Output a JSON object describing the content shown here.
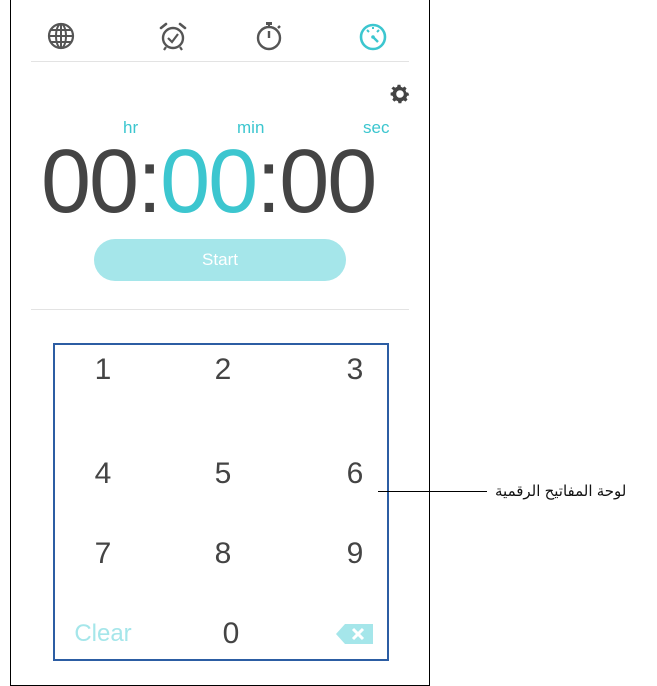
{
  "tabs": [
    {
      "name": "world-clock",
      "icon": "globe-icon"
    },
    {
      "name": "alarm",
      "icon": "alarm-clock-icon"
    },
    {
      "name": "stopwatch",
      "icon": "stopwatch-icon"
    },
    {
      "name": "timer",
      "icon": "timer-icon",
      "active": true
    }
  ],
  "colors": {
    "accent": "#3cc6cf",
    "accent_light": "#a5e6ea",
    "text": "#444444",
    "frame_blue": "#2c5da3"
  },
  "timer": {
    "units": {
      "hr": "hr",
      "min": "min",
      "sec": "sec"
    },
    "hours": "00",
    "minutes": "00",
    "seconds": "00",
    "separator": ":",
    "start_label": "Start"
  },
  "keypad": {
    "keys": [
      "1",
      "2",
      "3",
      "4",
      "5",
      "6",
      "7",
      "8",
      "9"
    ],
    "clear_label": "Clear",
    "zero_label": "0"
  },
  "callout": {
    "label": "لوحة المفاتيح الرقمية"
  }
}
